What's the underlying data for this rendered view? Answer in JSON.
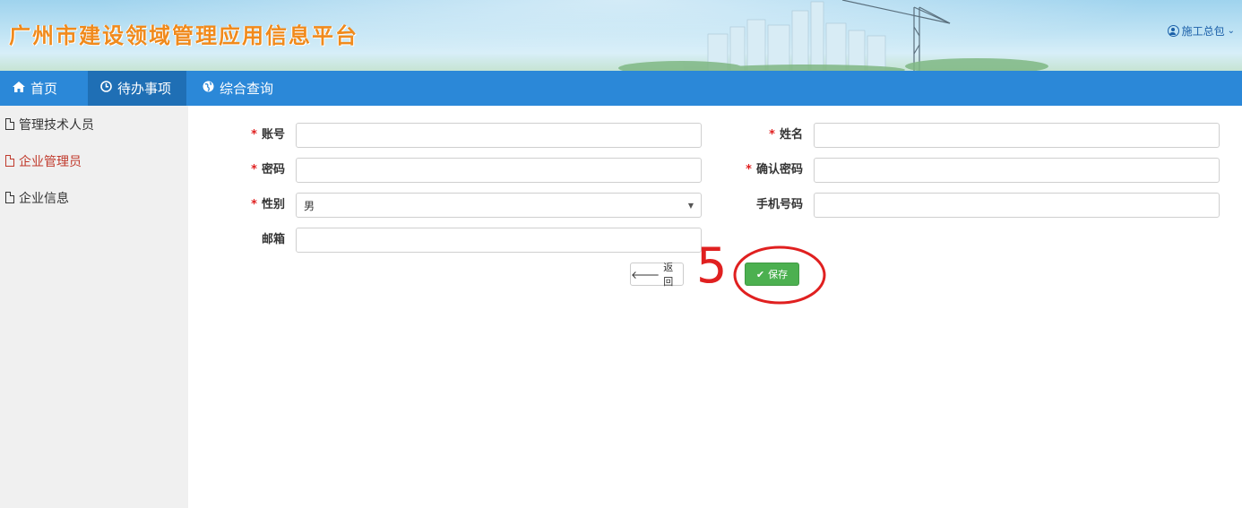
{
  "header": {
    "title": "广州市建设领域管理应用信息平台",
    "user_label": "施工总包",
    "user_icon": "user-circle-icon",
    "title_color": "#f08a1c"
  },
  "nav": {
    "items": [
      {
        "label": "首页",
        "icon": "home-icon",
        "glyph": "🏠",
        "active": false
      },
      {
        "label": "待办事项",
        "icon": "clock-icon",
        "glyph": "⊙",
        "active": true
      },
      {
        "label": "综合查询",
        "icon": "globe-icon",
        "glyph": "◕",
        "active": false
      }
    ],
    "bar_color": "#2b88d8"
  },
  "sidebar": {
    "items": [
      {
        "label": "管理技术人员",
        "active": false
      },
      {
        "label": "企业管理员",
        "active": true
      },
      {
        "label": "企业信息",
        "active": false
      }
    ]
  },
  "form": {
    "account_label": "账号",
    "account_value": "",
    "name_label": "姓名",
    "name_value": "",
    "password_label": "密码",
    "password_value": "",
    "confirm_label": "确认密码",
    "confirm_value": "",
    "gender_label": "性别",
    "gender_value": "男",
    "phone_label": "手机号码",
    "phone_value": "",
    "email_label": "邮箱",
    "email_value": "",
    "required_mark": "*"
  },
  "buttons": {
    "back_label": "返回",
    "back_icon": "arrow-left-icon",
    "save_label": "保存",
    "save_icon": "check-icon",
    "save_color": "#4cb050"
  },
  "annotation": {
    "step_number": "5",
    "color": "#e02020"
  }
}
